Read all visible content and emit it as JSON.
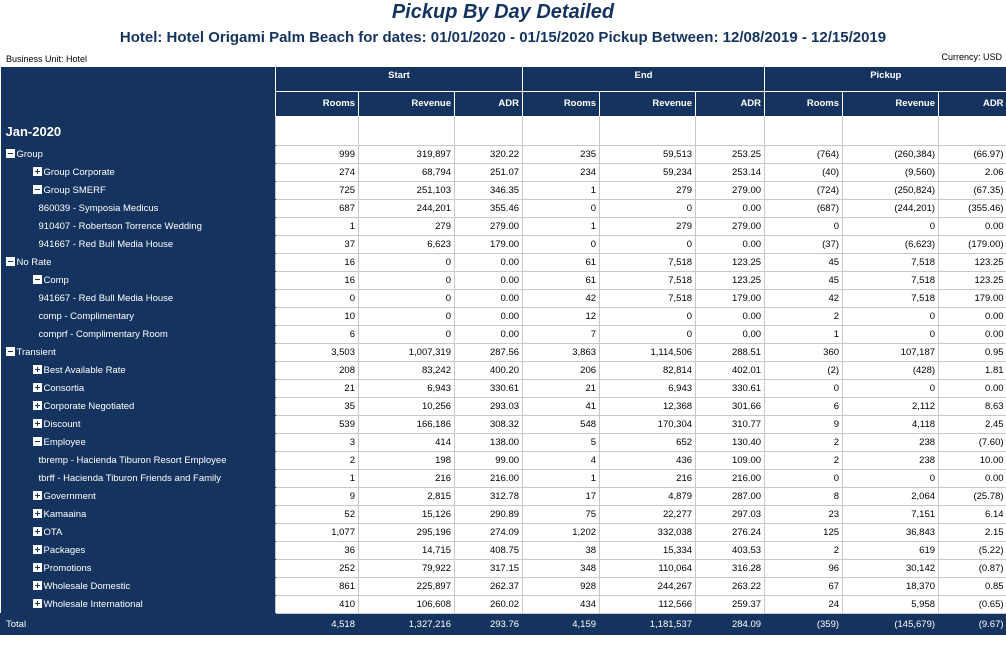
{
  "report": {
    "title": "Pickup By Day Detailed",
    "subtitle": "Hotel: Hotel Origami Palm Beach for dates: 01/01/2020 - 01/15/2020 Pickup Between: 12/08/2019 - 12/15/2019",
    "business_unit": "Business Unit: Hotel",
    "currency": "Currency: USD"
  },
  "column_groups": [
    "Start",
    "End",
    "Pickup"
  ],
  "columns": [
    "Rooms",
    "Revenue",
    "ADR",
    "Rooms",
    "Revenue",
    "ADR",
    "Rooms",
    "Revenue",
    "ADR"
  ],
  "month_label": "Jan-2020",
  "rows": [
    {
      "label": "Group",
      "level": 0,
      "toggle": "minus",
      "v": [
        "999",
        "319,897",
        "320.22",
        "235",
        "59,513",
        "253.25",
        "(764)",
        "(260,384)",
        "(66.97)"
      ]
    },
    {
      "label": "Group Corporate",
      "level": 1,
      "toggle": "plus",
      "v": [
        "274",
        "68,794",
        "251.07",
        "234",
        "59,234",
        "253.14",
        "(40)",
        "(9,560)",
        "2.06"
      ]
    },
    {
      "label": "Group SMERF",
      "level": 1,
      "toggle": "minus",
      "v": [
        "725",
        "251,103",
        "346.35",
        "1",
        "279",
        "279.00",
        "(724)",
        "(250,824)",
        "(67.35)"
      ]
    },
    {
      "label": "860039 - Symposia Medicus",
      "level": 2,
      "toggle": "",
      "v": [
        "687",
        "244,201",
        "355.46",
        "0",
        "0",
        "0.00",
        "(687)",
        "(244,201)",
        "(355.46)"
      ]
    },
    {
      "label": "910407 - Robertson Torrence Wedding",
      "level": 2,
      "toggle": "",
      "v": [
        "1",
        "279",
        "279.00",
        "1",
        "279",
        "279.00",
        "0",
        "0",
        "0.00"
      ]
    },
    {
      "label": "941667 - Red Bull Media House",
      "level": 2,
      "toggle": "",
      "v": [
        "37",
        "6,623",
        "179.00",
        "0",
        "0",
        "0.00",
        "(37)",
        "(6,623)",
        "(179.00)"
      ]
    },
    {
      "label": "No Rate",
      "level": 0,
      "toggle": "minus",
      "v": [
        "16",
        "0",
        "0.00",
        "61",
        "7,518",
        "123.25",
        "45",
        "7,518",
        "123.25"
      ]
    },
    {
      "label": "Comp",
      "level": 1,
      "toggle": "minus",
      "v": [
        "16",
        "0",
        "0.00",
        "61",
        "7,518",
        "123.25",
        "45",
        "7,518",
        "123.25"
      ]
    },
    {
      "label": "941667 - Red Bull Media House",
      "level": 2,
      "toggle": "",
      "v": [
        "0",
        "0",
        "0.00",
        "42",
        "7,518",
        "179.00",
        "42",
        "7,518",
        "179.00"
      ]
    },
    {
      "label": "comp - Complimentary",
      "level": 2,
      "toggle": "",
      "v": [
        "10",
        "0",
        "0.00",
        "12",
        "0",
        "0.00",
        "2",
        "0",
        "0.00"
      ]
    },
    {
      "label": "comprf - Complimentary Room",
      "level": 2,
      "toggle": "",
      "v": [
        "6",
        "0",
        "0.00",
        "7",
        "0",
        "0.00",
        "1",
        "0",
        "0.00"
      ]
    },
    {
      "label": "Transient",
      "level": 0,
      "toggle": "minus",
      "v": [
        "3,503",
        "1,007,319",
        "287.56",
        "3,863",
        "1,114,506",
        "288.51",
        "360",
        "107,187",
        "0.95"
      ]
    },
    {
      "label": "Best Available Rate",
      "level": 1,
      "toggle": "plus",
      "v": [
        "208",
        "83,242",
        "400.20",
        "206",
        "82,814",
        "402.01",
        "(2)",
        "(428)",
        "1.81"
      ]
    },
    {
      "label": "Consortia",
      "level": 1,
      "toggle": "plus",
      "v": [
        "21",
        "6,943",
        "330.61",
        "21",
        "6,943",
        "330.61",
        "0",
        "0",
        "0.00"
      ]
    },
    {
      "label": "Corporate Negotiated",
      "level": 1,
      "toggle": "plus",
      "v": [
        "35",
        "10,256",
        "293.03",
        "41",
        "12,368",
        "301.66",
        "6",
        "2,112",
        "8.63"
      ]
    },
    {
      "label": "Discount",
      "level": 1,
      "toggle": "plus",
      "v": [
        "539",
        "166,186",
        "308.32",
        "548",
        "170,304",
        "310.77",
        "9",
        "4,118",
        "2.45"
      ]
    },
    {
      "label": "Employee",
      "level": 1,
      "toggle": "minus",
      "v": [
        "3",
        "414",
        "138.00",
        "5",
        "652",
        "130.40",
        "2",
        "238",
        "(7.60)"
      ]
    },
    {
      "label": "tbremp - Hacienda Tiburon Resort Employee",
      "level": 2,
      "toggle": "",
      "v": [
        "2",
        "198",
        "99.00",
        "4",
        "436",
        "109.00",
        "2",
        "238",
        "10.00"
      ]
    },
    {
      "label": "tbrff - Hacienda Tiburon Friends and Family",
      "level": 2,
      "toggle": "",
      "v": [
        "1",
        "216",
        "216.00",
        "1",
        "216",
        "216.00",
        "0",
        "0",
        "0.00"
      ]
    },
    {
      "label": "Government",
      "level": 1,
      "toggle": "plus",
      "v": [
        "9",
        "2,815",
        "312.78",
        "17",
        "4,879",
        "287.00",
        "8",
        "2,064",
        "(25.78)"
      ]
    },
    {
      "label": "Kamaaina",
      "level": 1,
      "toggle": "plus",
      "v": [
        "52",
        "15,126",
        "290.89",
        "75",
        "22,277",
        "297.03",
        "23",
        "7,151",
        "6.14"
      ]
    },
    {
      "label": "OTA",
      "level": 1,
      "toggle": "plus",
      "v": [
        "1,077",
        "295,196",
        "274.09",
        "1,202",
        "332,038",
        "276.24",
        "125",
        "36,843",
        "2.15"
      ]
    },
    {
      "label": "Packages",
      "level": 1,
      "toggle": "plus",
      "v": [
        "36",
        "14,715",
        "408.75",
        "38",
        "15,334",
        "403.53",
        "2",
        "619",
        "(5.22)"
      ]
    },
    {
      "label": "Promotions",
      "level": 1,
      "toggle": "plus",
      "v": [
        "252",
        "79,922",
        "317.15",
        "348",
        "110,064",
        "316.28",
        "96",
        "30,142",
        "(0.87)"
      ]
    },
    {
      "label": "Wholesale Domestic",
      "level": 1,
      "toggle": "plus",
      "v": [
        "861",
        "225,897",
        "262.37",
        "928",
        "244,267",
        "263.22",
        "67",
        "18,370",
        "0.85"
      ]
    },
    {
      "label": "Wholesale International",
      "level": 1,
      "toggle": "plus",
      "v": [
        "410",
        "106,608",
        "260.02",
        "434",
        "112,566",
        "259.37",
        "24",
        "5,958",
        "(0.65)"
      ]
    }
  ],
  "total": {
    "label": "Total",
    "v": [
      "4,518",
      "1,327,216",
      "293.76",
      "4,159",
      "1,181,537",
      "284.09",
      "(359)",
      "(145,679)",
      "(9.67)"
    ]
  }
}
